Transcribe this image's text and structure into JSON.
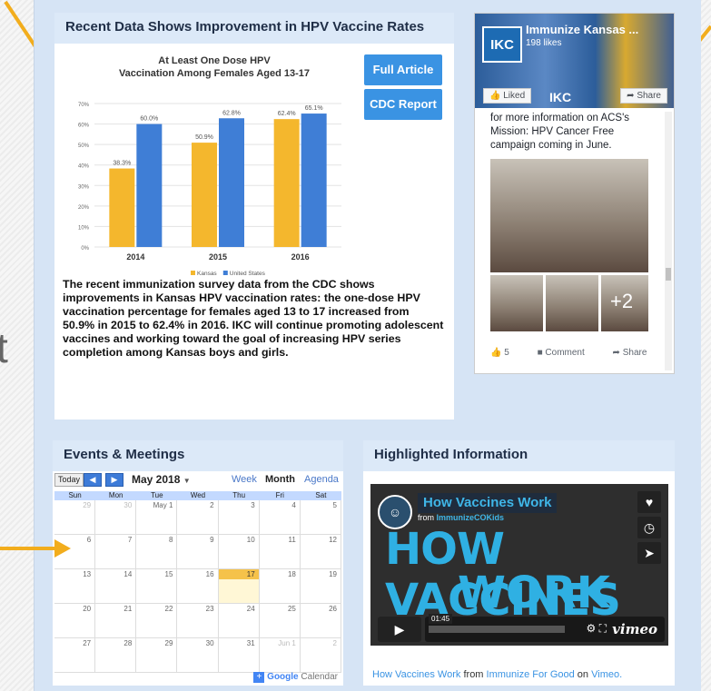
{
  "recent": {
    "heading": "Recent Data Shows Improvement in HPV Vaccine Rates",
    "full_article": "Full Article",
    "cdc_report": "CDC Report",
    "body": "The recent immunization survey data from the CDC shows improvements in Kansas HPV vaccination rates: the one-dose HPV vaccination percentage for females aged 13 to 17 increased from 50.9% in 2015 to 62.4% in 2016. IKC will continue promoting adolescent vaccines and working toward the goal of increasing HPV series completion among Kansas boys and girls."
  },
  "chart_data": {
    "type": "bar",
    "title": "At Least One Dose HPV Vaccination Among Females Aged 13-17",
    "categories": [
      "2014",
      "2015",
      "2016"
    ],
    "series": [
      {
        "name": "Kansas",
        "values": [
          38.3,
          50.9,
          62.4
        ],
        "color": "#f4b72d"
      },
      {
        "name": "United States",
        "values": [
          60.0,
          62.8,
          65.1
        ],
        "color": "#3f7ed6"
      }
    ],
    "value_labels": {
      "Kansas": [
        "38.3%",
        "50.9%",
        "62.4%"
      ],
      "United States": [
        "60.0%",
        "62.8%",
        "65.1%"
      ]
    },
    "yticks": [
      "0%",
      "10%",
      "20%",
      "30%",
      "40%",
      "50%",
      "60%",
      "70%"
    ],
    "ylim": [
      0,
      70
    ],
    "grid": true,
    "legend": "bottom"
  },
  "facebook": {
    "page_name": "Immunize Kansas ...",
    "likes": "198 likes",
    "logo": "IKC",
    "liked_label": "Liked",
    "share_label": "Share",
    "post_text": "for more information on ACS's Mission: HPV Cancer Free campaign coming in June.",
    "plus_more": "+2",
    "reactions": "5",
    "comment": "Comment",
    "share": "Share"
  },
  "events": {
    "heading": "Events & Meetings",
    "today": "Today",
    "month": "May 2018",
    "views": [
      "Week",
      "Month",
      "Agenda"
    ],
    "dow": [
      "Sun",
      "Mon",
      "Tue",
      "Wed",
      "Thu",
      "Fri",
      "Sat"
    ],
    "weeks": [
      [
        "29",
        "30",
        "May 1",
        "2",
        "3",
        "4",
        "5"
      ],
      [
        "6",
        "7",
        "8",
        "9",
        "10",
        "11",
        "12"
      ],
      [
        "13",
        "14",
        "15",
        "16",
        "17",
        "18",
        "19"
      ],
      [
        "20",
        "21",
        "22",
        "23",
        "24",
        "25",
        "26"
      ],
      [
        "27",
        "28",
        "29",
        "30",
        "31",
        "Jun 1",
        "2"
      ]
    ],
    "google_label": "Google",
    "calendar_label": "Calendar"
  },
  "highlight": {
    "heading": "Highlighted Information",
    "video_title": "How Vaccines Work",
    "from_label": "from",
    "from_source": "ImmunizeCOKids",
    "big_line1": "HOW VACCINES",
    "big_line2": "WORK",
    "time": "01:45",
    "vimeo": "vimeo",
    "caption_title": "How Vaccines Work",
    "caption_from": "from",
    "caption_org": "Immunize For Good",
    "caption_on": "on",
    "caption_site": "Vimeo."
  }
}
